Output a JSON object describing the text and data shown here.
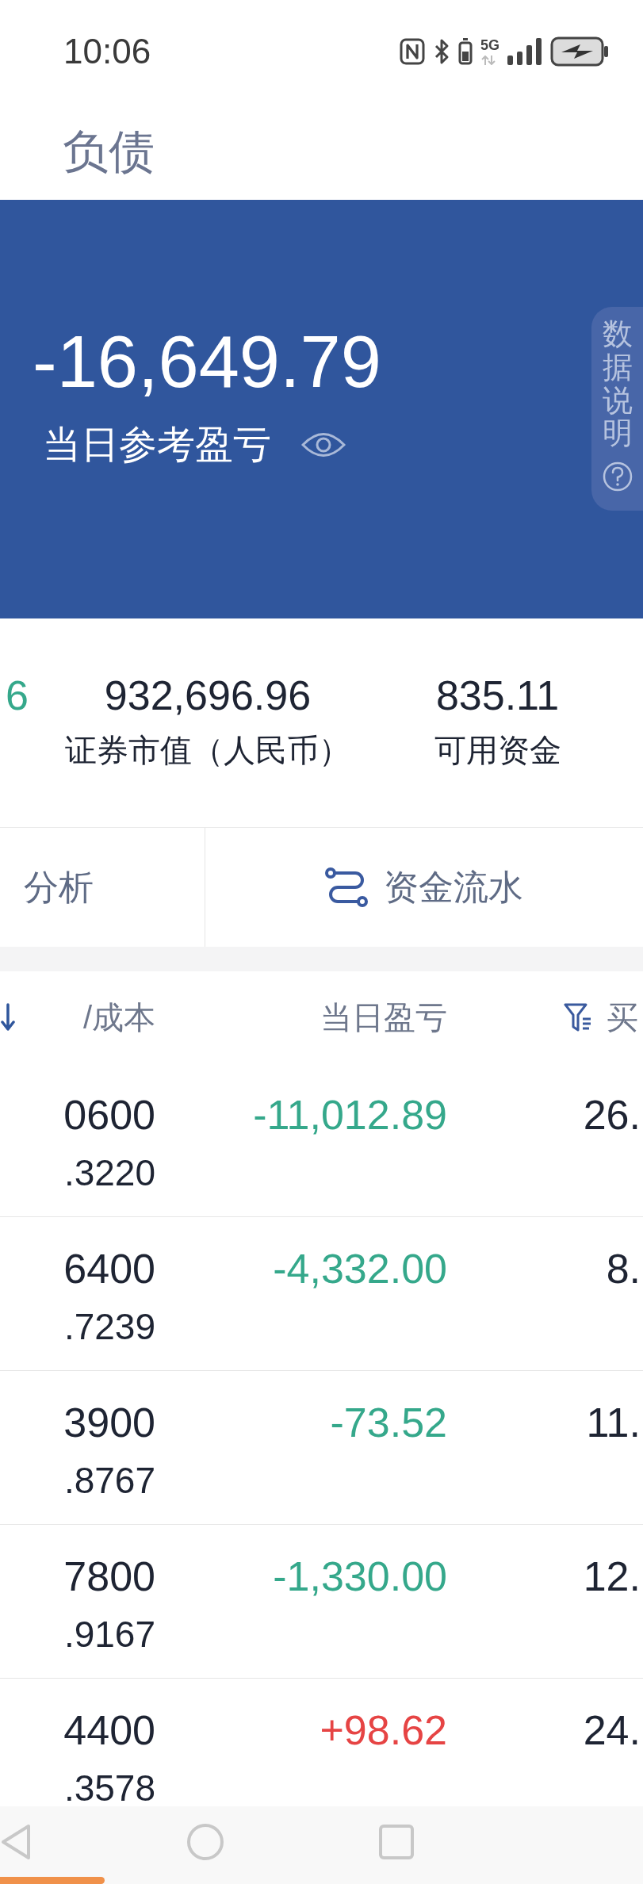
{
  "status_bar": {
    "time": "10:06",
    "network": "5G"
  },
  "header": {
    "title": "负债"
  },
  "banner": {
    "value": "-16,649.79",
    "label": "当日参考盈亏",
    "side_tab": "数据说明"
  },
  "stats": [
    {
      "value": "6",
      "negative": true
    },
    {
      "value": "932,696.96",
      "label": "证券市值（人民币）"
    },
    {
      "value": "835.11",
      "label": "可用资金"
    }
  ],
  "actions": [
    {
      "label": "分析",
      "icon": false
    },
    {
      "label": "资金流水",
      "icon": true
    }
  ],
  "table": {
    "columns": [
      {
        "label": "/成本",
        "sorted": true
      },
      {
        "label": "当日盈亏"
      },
      {
        "label": "买",
        "filter": true
      }
    ],
    "rows": [
      {
        "price": "0600",
        "cost": ".3220",
        "daily_pl": "-11,012.89",
        "negative": true,
        "column_3": "26."
      },
      {
        "price": "6400",
        "cost": ".7239",
        "daily_pl": "-4,332.00",
        "negative": true,
        "column_3": "8."
      },
      {
        "price": "3900",
        "cost": ".8767",
        "daily_pl": "-73.52",
        "negative": true,
        "column_3": "11."
      },
      {
        "price": "7800",
        "cost": ".9167",
        "daily_pl": "-1,330.00",
        "negative": true,
        "column_3": "12."
      },
      {
        "price": "4400",
        "cost": ".3578",
        "daily_pl": "+98.62",
        "negative": false,
        "column_3": "24."
      }
    ]
  }
}
